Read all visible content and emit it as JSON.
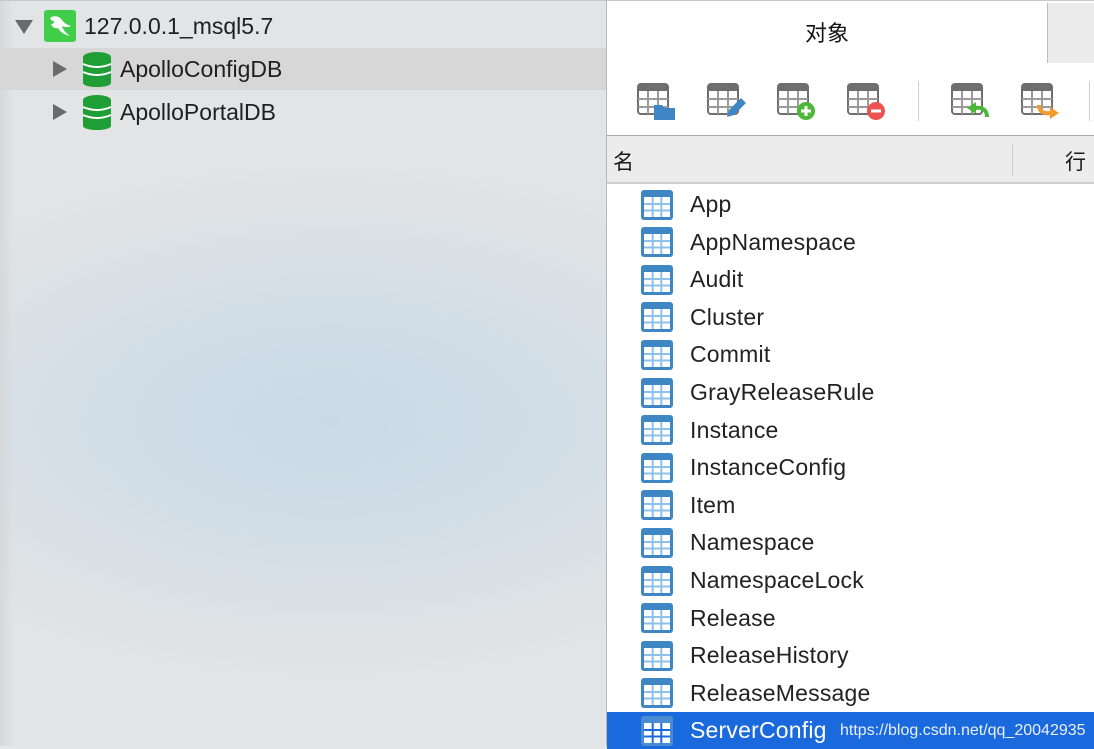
{
  "sidebar": {
    "connection": {
      "label": "127.0.0.1_msql5.7",
      "expanded": true,
      "icon": "mysql-dolphin-icon"
    },
    "databases": [
      {
        "label": "ApolloConfigDB",
        "expanded": false,
        "selected": true,
        "icon": "database-icon"
      },
      {
        "label": "ApolloPortalDB",
        "expanded": false,
        "selected": false,
        "icon": "database-icon"
      }
    ]
  },
  "panel": {
    "tab_label": "对象",
    "toolbar": [
      {
        "name": "open-table",
        "icon": "table-open-folder-icon"
      },
      {
        "name": "design-table",
        "icon": "table-edit-pencil-icon"
      },
      {
        "name": "new-table",
        "icon": "table-add-icon"
      },
      {
        "name": "delete-table",
        "icon": "table-delete-icon"
      },
      {
        "name": "import-wizard",
        "icon": "table-import-icon"
      },
      {
        "name": "export-wizard",
        "icon": "table-export-icon"
      }
    ],
    "columns": {
      "name": "名",
      "rows": "行"
    },
    "tables": [
      "App",
      "AppNamespace",
      "Audit",
      "Cluster",
      "Commit",
      "GrayReleaseRule",
      "Instance",
      "InstanceConfig",
      "Item",
      "Namespace",
      "NamespaceLock",
      "Release",
      "ReleaseHistory",
      "ReleaseMessage",
      "ServerConfig"
    ],
    "selected_table": "ServerConfig"
  },
  "watermark": "https://blog.csdn.net/qq_20042935",
  "colors": {
    "selection": "#1a6ade",
    "db_green": "#1f9e36",
    "mysql_green": "#3fcd4a",
    "table_icon_blue": "#3f86c4",
    "add_green": "#4cb83a",
    "delete_red": "#ec5350",
    "export_orange": "#f29a2e"
  }
}
